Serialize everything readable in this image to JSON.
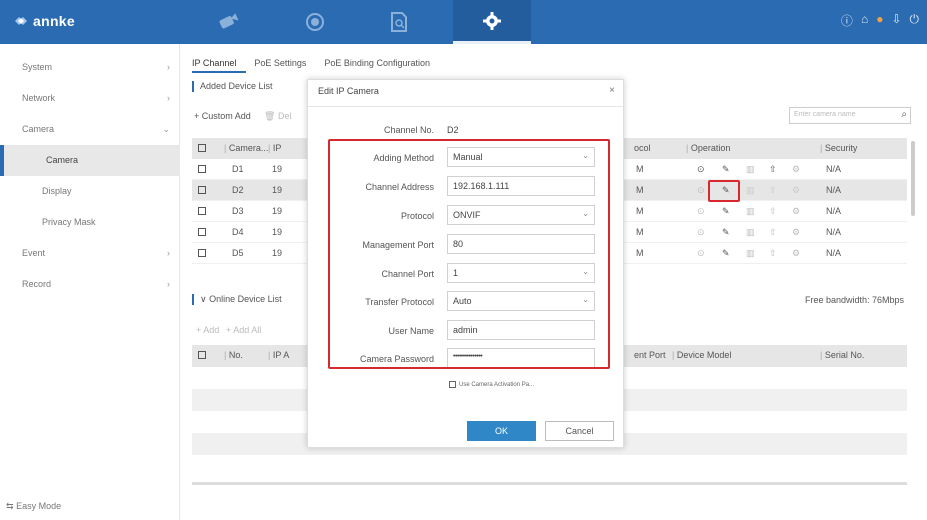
{
  "brand": {
    "logo_text": "annke",
    "color": "#2a6bb2"
  },
  "nav": [
    {
      "icon": "camera-icon",
      "active": false
    },
    {
      "icon": "playback-icon",
      "active": false
    },
    {
      "icon": "file-search-icon",
      "active": false
    },
    {
      "icon": "gear-icon",
      "active": true
    }
  ],
  "top_icons": [
    "info-icon",
    "home-icon",
    "user-icon",
    "export-icon",
    "power-icon"
  ],
  "sidebar": {
    "items": [
      {
        "label": "System",
        "arrow": ">"
      },
      {
        "label": "Network",
        "arrow": ">"
      },
      {
        "label": "Camera",
        "arrow": "v"
      },
      {
        "label": "Camera",
        "arrow": ""
      },
      {
        "label": "Display",
        "arrow": ""
      },
      {
        "label": "Privacy Mask",
        "arrow": ""
      },
      {
        "label": "Event",
        "arrow": ">"
      },
      {
        "label": "Record",
        "arrow": ">"
      }
    ],
    "easy_mode": "Easy Mode"
  },
  "tabs": [
    "IP Channel",
    "PoE Settings",
    "PoE Binding Configuration"
  ],
  "added": {
    "title": "Added Device List",
    "custom_add": "+ Custom Add",
    "delete": "Del",
    "search_placeholder": "Enter camera name",
    "headers": {
      "camera": "Camera...",
      "ip": "IP",
      "protocol": "ocol",
      "operation": "Operation",
      "security": "Security"
    },
    "rows": [
      {
        "name": "D1",
        "ip": "19",
        "protocol": "M",
        "security": "N/A"
      },
      {
        "name": "D2",
        "ip": "19",
        "protocol": "M",
        "security": "N/A"
      },
      {
        "name": "D3",
        "ip": "19",
        "protocol": "M",
        "security": "N/A"
      },
      {
        "name": "D4",
        "ip": "19",
        "protocol": "M",
        "security": "N/A"
      },
      {
        "name": "D5",
        "ip": "19",
        "protocol": "M",
        "security": "N/A"
      }
    ]
  },
  "online": {
    "title": "Online Device List",
    "add": "+ Add",
    "add_all": "+ Add All",
    "bandwidth": "Free bandwidth: 76Mbps",
    "headers": {
      "no": "No.",
      "ip": "IP A",
      "port": "ent Port",
      "model": "Device Model",
      "serial": "Serial No."
    }
  },
  "modal": {
    "title": "Edit IP Camera",
    "close": "×",
    "fields": [
      {
        "label": "Channel No.",
        "value": "D2",
        "type": "text"
      },
      {
        "label": "Adding Method",
        "value": "Manual",
        "type": "select"
      },
      {
        "label": "Channel Address",
        "value": "192.168.1.111",
        "type": "input"
      },
      {
        "label": "Protocol",
        "value": "ONVIF",
        "type": "select"
      },
      {
        "label": "Management Port",
        "value": "80",
        "type": "input"
      },
      {
        "label": "Channel Port",
        "value": "1",
        "type": "select"
      },
      {
        "label": "Transfer Protocol",
        "value": "Auto",
        "type": "select"
      },
      {
        "label": "User Name",
        "value": "admin",
        "type": "input"
      },
      {
        "label": "Camera Password",
        "value": "•••••••••••••••",
        "type": "input"
      }
    ],
    "activation_checkbox": "Use Camera Activation Pa...",
    "ok": "OK",
    "cancel": "Cancel"
  },
  "highlight_color": "#d7282f"
}
